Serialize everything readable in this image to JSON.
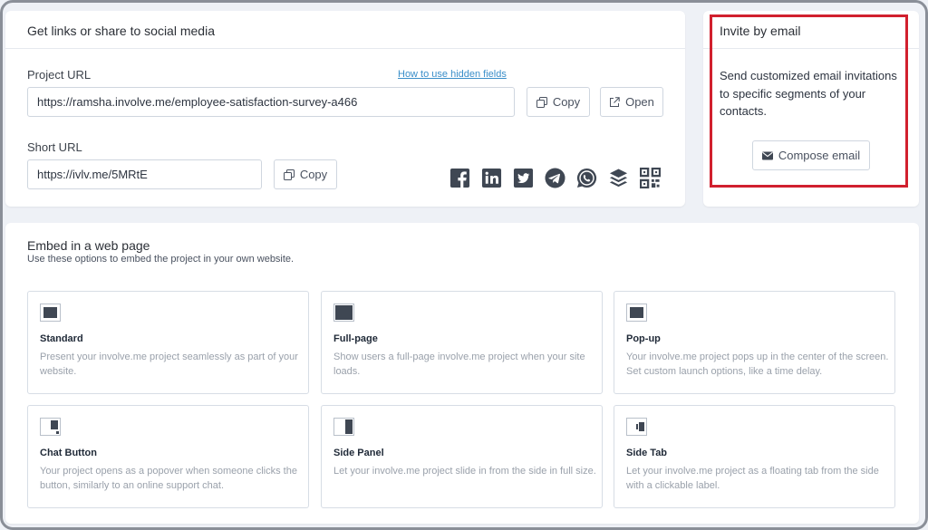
{
  "share": {
    "title": "Get links or share to social media",
    "project_url_label": "Project URL",
    "hidden_fields_link": "How to use hidden fields",
    "project_url_value": "https://ramsha.involve.me/employee-satisfaction-survey-a466",
    "copy_label": "Copy",
    "open_label": "Open",
    "short_url_label": "Short URL",
    "short_url_value": "https://ivlv.me/5MRtE",
    "social_icons": [
      "facebook-icon",
      "linkedin-icon",
      "twitter-icon",
      "telegram-icon",
      "whatsapp-icon",
      "buffer-icon",
      "qr-code-icon"
    ]
  },
  "invite": {
    "title": "Invite by email",
    "description": "Send customized email invitations to specific segments of your contacts.",
    "compose_label": "Compose email",
    "highlight_color": "#d1202e"
  },
  "embed": {
    "title": "Embed in a web page",
    "subtitle": "Use these options to embed the project in your own website.",
    "options": [
      {
        "title": "Standard",
        "description": "Present your involve.me project seamlessly as part of your website."
      },
      {
        "title": "Full-page",
        "description": "Show users a full-page involve.me project when your site loads."
      },
      {
        "title": "Pop-up",
        "description": "Your involve.me project pops up in the center of the screen. Set custom launch options, like a time delay."
      },
      {
        "title": "Chat Button",
        "description": "Your project opens as a popover when someone clicks the button, similarly to an online support chat."
      },
      {
        "title": "Side Panel",
        "description": "Let your involve.me project slide in from the side in full size."
      },
      {
        "title": "Side Tab",
        "description": "Let your involve.me project as a floating tab from the side with a clickable label."
      }
    ]
  },
  "colors": {
    "link": "#3a8ec9",
    "icon": "#3f4753",
    "page_bg": "#eef1f6"
  }
}
